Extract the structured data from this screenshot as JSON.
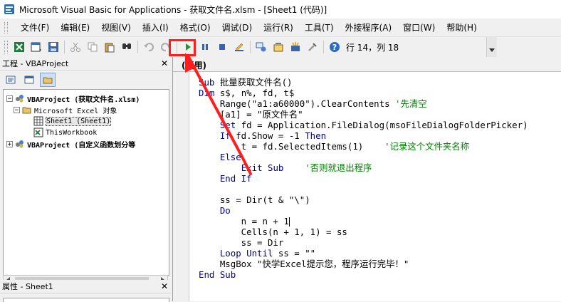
{
  "window": {
    "title": "Microsoft Visual Basic for Applications - 获取文件名.xlsm - [Sheet1 (代码)]"
  },
  "menu": [
    "文件(F)",
    "编辑(E)",
    "视图(V)",
    "插入(I)",
    "格式(O)",
    "调试(D)",
    "运行(R)",
    "工具(T)",
    "外接程序(A)",
    "窗口(W)",
    "帮助(H)"
  ],
  "toolbar": {
    "position": "行 14，列 18",
    "icons": [
      "excel-icon",
      "insert-userform-icon",
      "save-icon",
      "cut-icon",
      "copy-icon",
      "paste-icon",
      "find-icon",
      "undo-icon",
      "redo-icon",
      "run-icon",
      "break-icon",
      "reset-icon",
      "design-mode-icon",
      "project-explorer-icon",
      "properties-icon",
      "object-browser-icon",
      "toolbox-icon",
      "help-icon"
    ]
  },
  "project_panel": {
    "title": "工程 - VBAProject",
    "tree": [
      {
        "label": "VBAProject (获取文件名.xlsm)",
        "bold": true,
        "level": 0
      },
      {
        "label": "Microsoft Excel 对象",
        "bold": false,
        "level": 1
      },
      {
        "label": "Sheet1 (Sheet1)",
        "bold": false,
        "level": 2
      },
      {
        "label": "ThisWorkbook",
        "bold": false,
        "level": 2
      },
      {
        "label": "VBAProject (自定义函数划分等",
        "bold": true,
        "level": 0
      }
    ]
  },
  "properties_panel": {
    "title": "属性 - Sheet1"
  },
  "code_window": {
    "object_combo": "(通用)",
    "lines": [
      [
        [
          "kw",
          "Sub"
        ],
        [
          "t",
          " 批量获取文件名()"
        ]
      ],
      [
        [
          "kw",
          "Dim"
        ],
        [
          "t",
          " s$, n%, fd, t$"
        ]
      ],
      [
        [
          "t",
          "    Range(\"a1:a60000\").ClearContents "
        ],
        [
          "cm",
          "'先清空"
        ]
      ],
      [
        [
          "t",
          "    [a1] = \"原文件名\""
        ]
      ],
      [
        [
          "t",
          "    "
        ],
        [
          "kw",
          "Set"
        ],
        [
          "t",
          " fd = Application.FileDialog(msoFileDialogFolderPicker)"
        ]
      ],
      [
        [
          "t",
          "    "
        ],
        [
          "kw",
          "If"
        ],
        [
          "t",
          " fd.Show = -1 "
        ],
        [
          "kw",
          "Then"
        ]
      ],
      [
        [
          "t",
          "        t = fd.SelectedItems(1)    "
        ],
        [
          "cm",
          "'记录这个文件夹名称"
        ]
      ],
      [
        [
          "t",
          "    "
        ],
        [
          "kw",
          "Else"
        ]
      ],
      [
        [
          "t",
          "        "
        ],
        [
          "kw",
          "Exit Sub"
        ],
        [
          "t",
          "    "
        ],
        [
          "cm",
          "'否则就退出程序"
        ]
      ],
      [
        [
          "t",
          "    "
        ],
        [
          "kw",
          "End If"
        ]
      ],
      [
        [
          "t",
          ""
        ]
      ],
      [
        [
          "t",
          "    ss = Dir(t & \"\\\")"
        ]
      ],
      [
        [
          "t",
          "    "
        ],
        [
          "kw",
          "Do"
        ]
      ],
      [
        [
          "t",
          "        n = n + 1"
        ]
      ],
      [
        [
          "t",
          "        Cells(n + 1, 1) = ss"
        ]
      ],
      [
        [
          "t",
          "        ss = Dir"
        ]
      ],
      [
        [
          "t",
          "    "
        ],
        [
          "kw",
          "Loop Until"
        ],
        [
          "t",
          " ss = \"\""
        ]
      ],
      [
        [
          "t",
          "    MsgBox \"快学Excel提示您，程序运行完毕！\""
        ]
      ],
      [
        [
          "kw",
          "End Sub"
        ]
      ]
    ]
  },
  "annotation": {
    "highlight_color": "#ff1e1e"
  }
}
